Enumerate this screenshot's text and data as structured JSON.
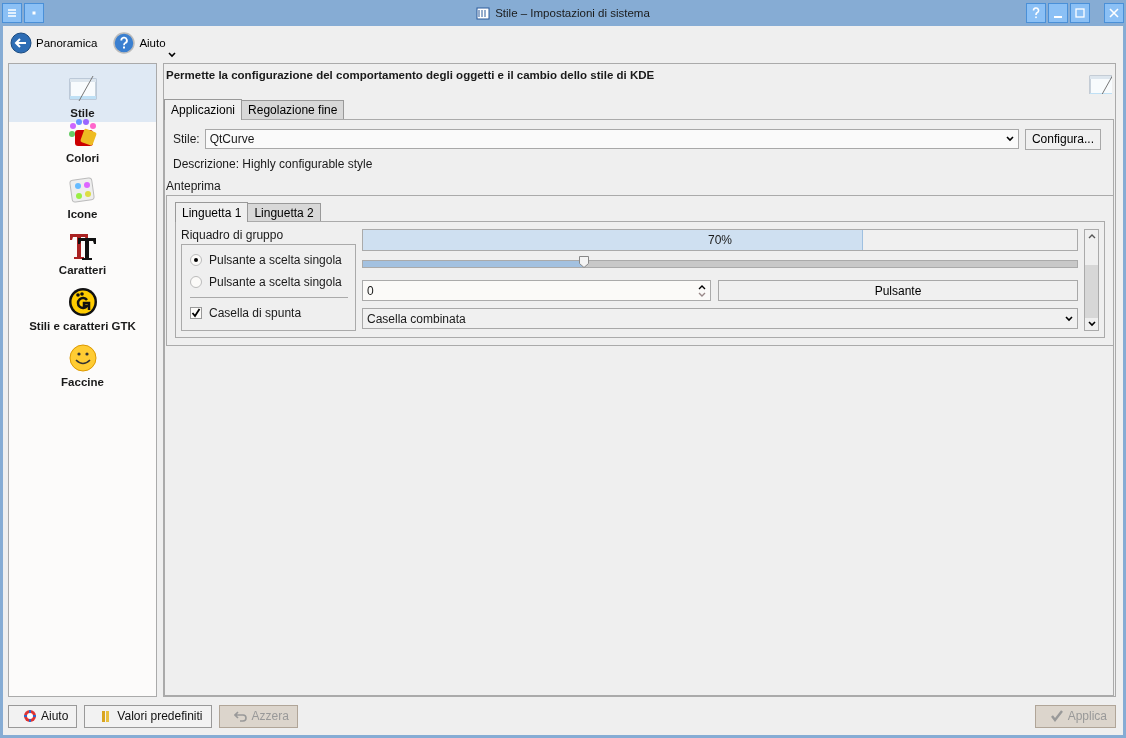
{
  "window": {
    "title": "Stile – Impostazioni di sistema"
  },
  "toolbar": [
    {
      "kind": "back",
      "label": "Panoramica"
    },
    {
      "kind": "help",
      "label": "Aiuto",
      "menu": true
    }
  ],
  "sidebar": {
    "items": [
      {
        "kind": "style",
        "label": "Stile",
        "selected": true
      },
      {
        "kind": "colors",
        "label": "Colori",
        "selected": false
      },
      {
        "kind": "icons",
        "label": "Icone",
        "selected": false
      },
      {
        "kind": "fonts",
        "label": "Caratteri",
        "selected": false
      },
      {
        "kind": "gtk",
        "label": "Stili e caratteri GTK",
        "selected": false
      },
      {
        "kind": "emoticons",
        "label": "Faccine",
        "selected": false
      }
    ]
  },
  "header": {
    "text": "Permette la configurazione del comportamento degli oggetti e il cambio dello stile di KDE"
  },
  "tabs": [
    {
      "label": "Applicazioni",
      "selected": true
    },
    {
      "label": "Regolazione fine",
      "selected": false
    }
  ],
  "style": {
    "label": "Stile:",
    "value": "QtCurve",
    "button": "Configura...",
    "description_label": "Descrizione:",
    "description": "Highly configurable style"
  },
  "preview": {
    "title": "Anteprima",
    "tabs": [
      {
        "label": "Linguetta 1",
        "selected": true
      },
      {
        "label": "Linguetta 2",
        "selected": false
      }
    ],
    "group_title": "Riquadro di gruppo",
    "radios": [
      {
        "label": "Pulsante a scelta singola",
        "selected": true
      },
      {
        "label": "Pulsante a scelta singola",
        "selected": false
      }
    ],
    "checkbox": {
      "label": "Casella di spunta",
      "checked": true
    },
    "progress": {
      "level": 0.7,
      "reading": "70%"
    },
    "slider": {
      "level": 0.31
    },
    "spin": {
      "value": "0"
    },
    "button": "Pulsante",
    "combo": "Casella combinata"
  },
  "footer": {
    "left": [
      {
        "kind": "help",
        "label": "Aiuto",
        "disabled": false
      },
      {
        "kind": "defaults",
        "label": "Valori predefiniti",
        "disabled": false
      },
      {
        "kind": "reset",
        "label": "Azzera",
        "disabled": true
      }
    ],
    "right": [
      {
        "kind": "apply",
        "label": "Applica",
        "disabled": true
      }
    ]
  }
}
